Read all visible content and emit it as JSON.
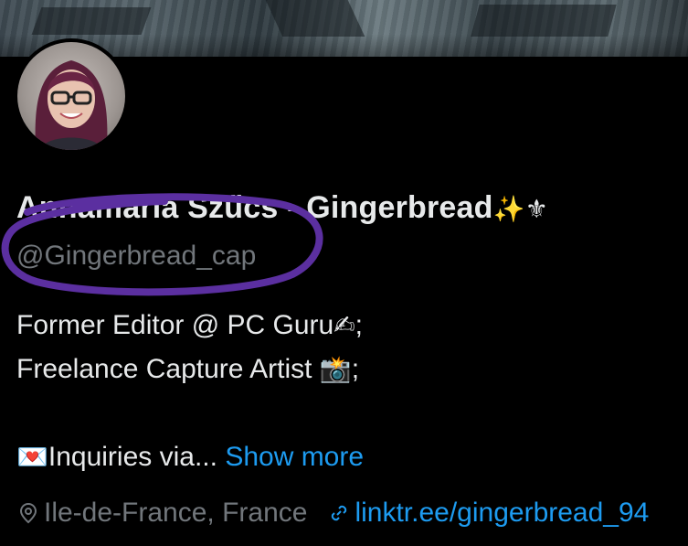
{
  "profile": {
    "display_name": "Annamaria Szűcs - Gingerbread",
    "name_emojis": "✨⚜",
    "handle": "@Gingerbread_cap"
  },
  "bio": {
    "line1_text": "Former Editor @ PC Guru",
    "line1_emoji": "✍",
    "line1_suffix": ";",
    "line2_text": "Freelance Capture Artist ",
    "line2_emoji": "📸",
    "line2_suffix": ";",
    "line3_emoji": "💌",
    "line3_text": "Inquiries via...",
    "show_more": "Show more"
  },
  "meta": {
    "location": "Ile-de-France, France",
    "link": "linktr.ee/gingerbread_94",
    "location_icon": "location-pin-icon",
    "link_icon": "link-icon"
  },
  "annotation": {
    "color": "#5b2fa0"
  }
}
